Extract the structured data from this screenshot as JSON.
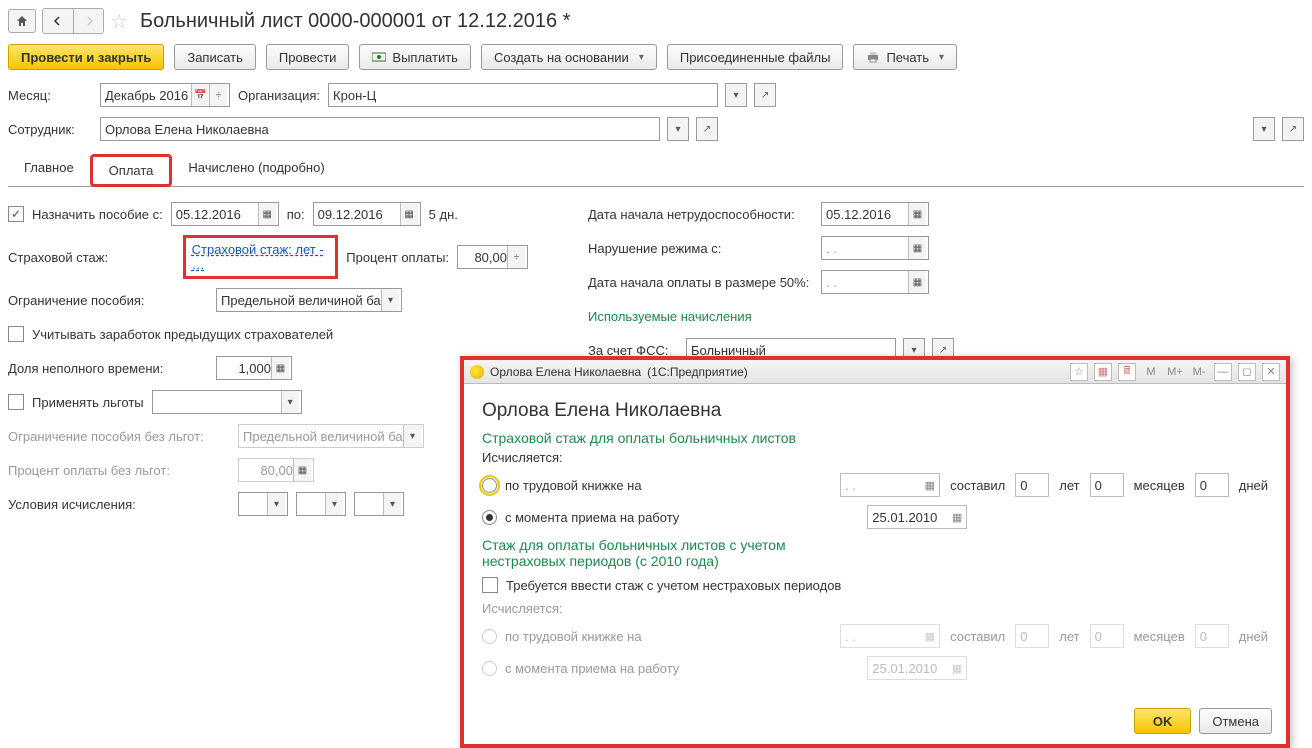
{
  "header": {
    "title": "Больничный лист 0000-000001 от 12.12.2016 *"
  },
  "toolbar": {
    "apply_close": "Провести и закрыть",
    "save": "Записать",
    "apply": "Провести",
    "pay": "Выплатить",
    "create_based_on": "Создать на основании",
    "attachments": "Присоединенные файлы",
    "print": "Печать"
  },
  "fields": {
    "month_lbl": "Месяц:",
    "month_val": "Декабрь 2016",
    "org_lbl": "Организация:",
    "org_val": "Крон-Ц",
    "employee_lbl": "Сотрудник:",
    "employee_val": "Орлова Елена Николаевна"
  },
  "tabs": {
    "main": "Главное",
    "payment": "Оплата",
    "accrued": "Начислено (подробно)"
  },
  "left": {
    "assign_from": "Назначить пособие с:",
    "date_from": "05.12.2016",
    "to": "по:",
    "date_to": "09.12.2016",
    "days": "5 дн.",
    "stazh_lbl": "Страховой стаж:",
    "stazh_link": "Страховой стаж: лет - …",
    "pay_pct_lbl": "Процент оплаты:",
    "pay_pct": "80,00",
    "limit_lbl": "Ограничение пособия:",
    "limit_val": "Предельной величиной ба",
    "prev_insurer": "Учитывать заработок предыдущих страхователей",
    "partial_lbl": "Доля неполного времени:",
    "partial_val": "1,000",
    "benefits": "Применять льготы",
    "limit_nol_lbl": "Ограничение пособия без льгот:",
    "limit_nol_val": "Предельной величиной ба",
    "pct_nol_lbl": "Процент оплаты без льгот:",
    "pct_nol_val": "80,00",
    "calc_cond_lbl": "Условия исчисления:"
  },
  "right": {
    "disabled_start_lbl": "Дата начала нетрудоспособности:",
    "disabled_start_val": "05.12.2016",
    "violation_lbl": "Нарушение режима с:",
    "violation_val": ".  .",
    "half_pay_lbl": "Дата начала оплаты в размере 50%:",
    "half_pay_val": ".  .",
    "accruals_used": "Используемые начисления",
    "fss_lbl": "За счет ФСС:",
    "fss_val": "Больничный"
  },
  "popup": {
    "title_app": "(1С:Предприятие)",
    "person": "Орлова Елена Николаевна",
    "h1": "Орлова Елена Николаевна",
    "sec1": "Страховой стаж для оплаты больничных листов",
    "calc_lbl": "Исчисляется:",
    "opt_book": "по трудовой книжке на",
    "opt_hire": "с момента приема на работу",
    "date_empty": ".  .",
    "was": "составил",
    "zero": "0",
    "years": "лет",
    "months": "месяцев",
    "days": "дней",
    "hire_date": "25.01.2010",
    "sec2": "Стаж для оплаты больничных листов с учетом нестраховых периодов (с 2010 года)",
    "need_nonins": "Требуется ввести стаж с учетом нестраховых периодов",
    "ok": "OK",
    "cancel": "Отмена",
    "m": "M",
    "mplus": "M+",
    "mminus": "M-"
  }
}
